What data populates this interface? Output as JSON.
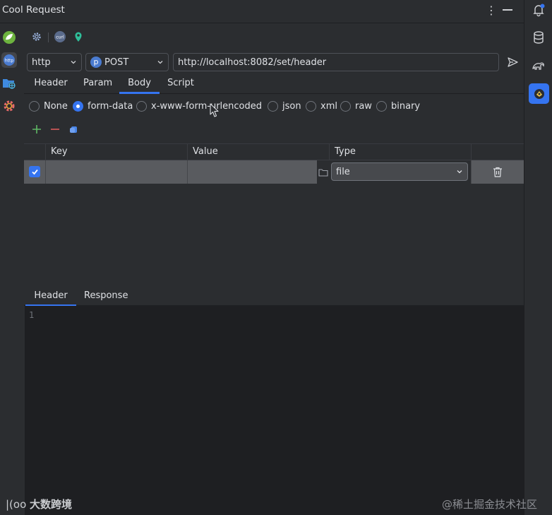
{
  "window": {
    "title": "Cool Request"
  },
  "request": {
    "protocol": "http",
    "method_badge": "p",
    "method": "POST",
    "url": "http://localhost:8082/set/header"
  },
  "tabs": [
    {
      "label": "Header"
    },
    {
      "label": "Param"
    },
    {
      "label": "Body",
      "active": true
    },
    {
      "label": "Script"
    }
  ],
  "body_types": [
    {
      "label": "None",
      "checked": false
    },
    {
      "label": "form-data",
      "checked": true
    },
    {
      "label": "x-www-form-urlencoded",
      "checked": false
    },
    {
      "label": "json",
      "checked": false
    },
    {
      "label": "xml",
      "checked": false
    },
    {
      "label": "raw",
      "checked": false
    },
    {
      "label": "binary",
      "checked": false
    }
  ],
  "form_table": {
    "columns": [
      "Key",
      "Value",
      "Type"
    ],
    "rows": [
      {
        "checked": true,
        "key": "",
        "value": "",
        "type": "file"
      }
    ]
  },
  "response_tabs": [
    {
      "label": "Header",
      "active": true
    },
    {
      "label": "Response"
    }
  ],
  "editor": {
    "line_number": "1"
  },
  "watermarks": {
    "left": "大数跨境",
    "right": "@稀土掘金技术社区"
  },
  "colors": {
    "accent": "#3574f0",
    "background": "#2b2d30",
    "editor_bg": "#1e1f22",
    "add": "#5fb865",
    "remove": "#db5c5c"
  }
}
